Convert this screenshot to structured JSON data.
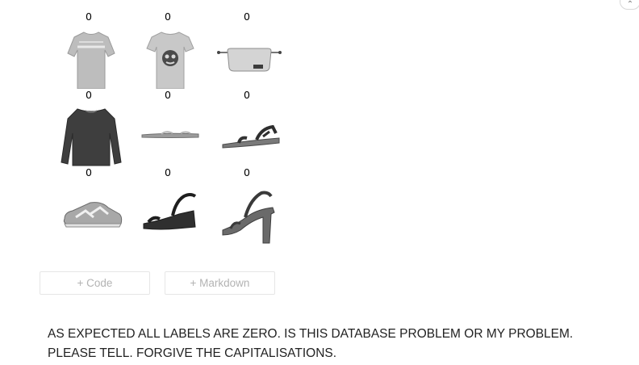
{
  "output_grid": {
    "labels": [
      "0",
      "0",
      "0",
      "0",
      "0",
      "0",
      "0",
      "0",
      "0"
    ],
    "image_icons": [
      "tshirt-icon",
      "graphic-tshirt-icon",
      "belt-bag-icon",
      "sweater-icon",
      "flat-sandal-icon",
      "strap-sandal-icon",
      "sneaker-icon",
      "wedge-sandal-icon",
      "heeled-sandal-icon"
    ]
  },
  "toolbar": {
    "collapse_glyph": "⌃",
    "add_code_label": "+ Code",
    "add_markdown_label": "+ Markdown"
  },
  "comment": {
    "line1": "AS EXPECTED ALL LABELS ARE ZERO. IS THIS DATABASE PROBLEM OR MY PROBLEM.",
    "line2": "PLEASE TELL. FORGIVE THE CAPITALISATIONS."
  }
}
